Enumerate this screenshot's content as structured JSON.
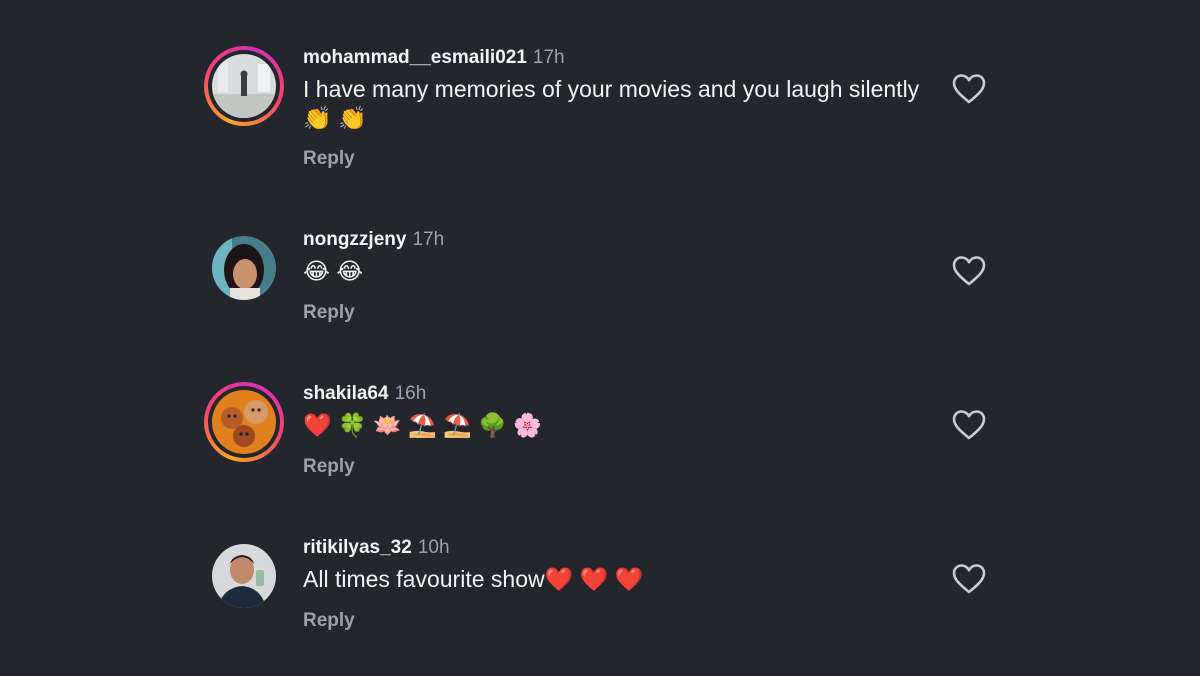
{
  "comments": [
    {
      "username": "mohammad__esmaili021",
      "time": "17h",
      "text": "I have many memories of your movies and you laugh silently👏 👏",
      "reply": "Reply"
    },
    {
      "username": "nongzzjeny",
      "time": "17h",
      "text": "😂 😂",
      "reply": "Reply"
    },
    {
      "username": "shakila64",
      "time": "16h",
      "text": "❤️ 🍀 🪷 ⛱️ ⛱️ 🌳 🌸",
      "reply": "Reply"
    },
    {
      "username": "ritikilyas_32",
      "time": "10h",
      "text": "All times favourite show❤️ ❤️ ❤️",
      "reply": "Reply"
    }
  ],
  "icons": {
    "like": "heart-outline-icon"
  },
  "colors": {
    "background": "#23262d",
    "secondary_text": "#9ea2a8",
    "story_ring": [
      "#f9a826",
      "#f5426c",
      "#d62fb2"
    ]
  }
}
